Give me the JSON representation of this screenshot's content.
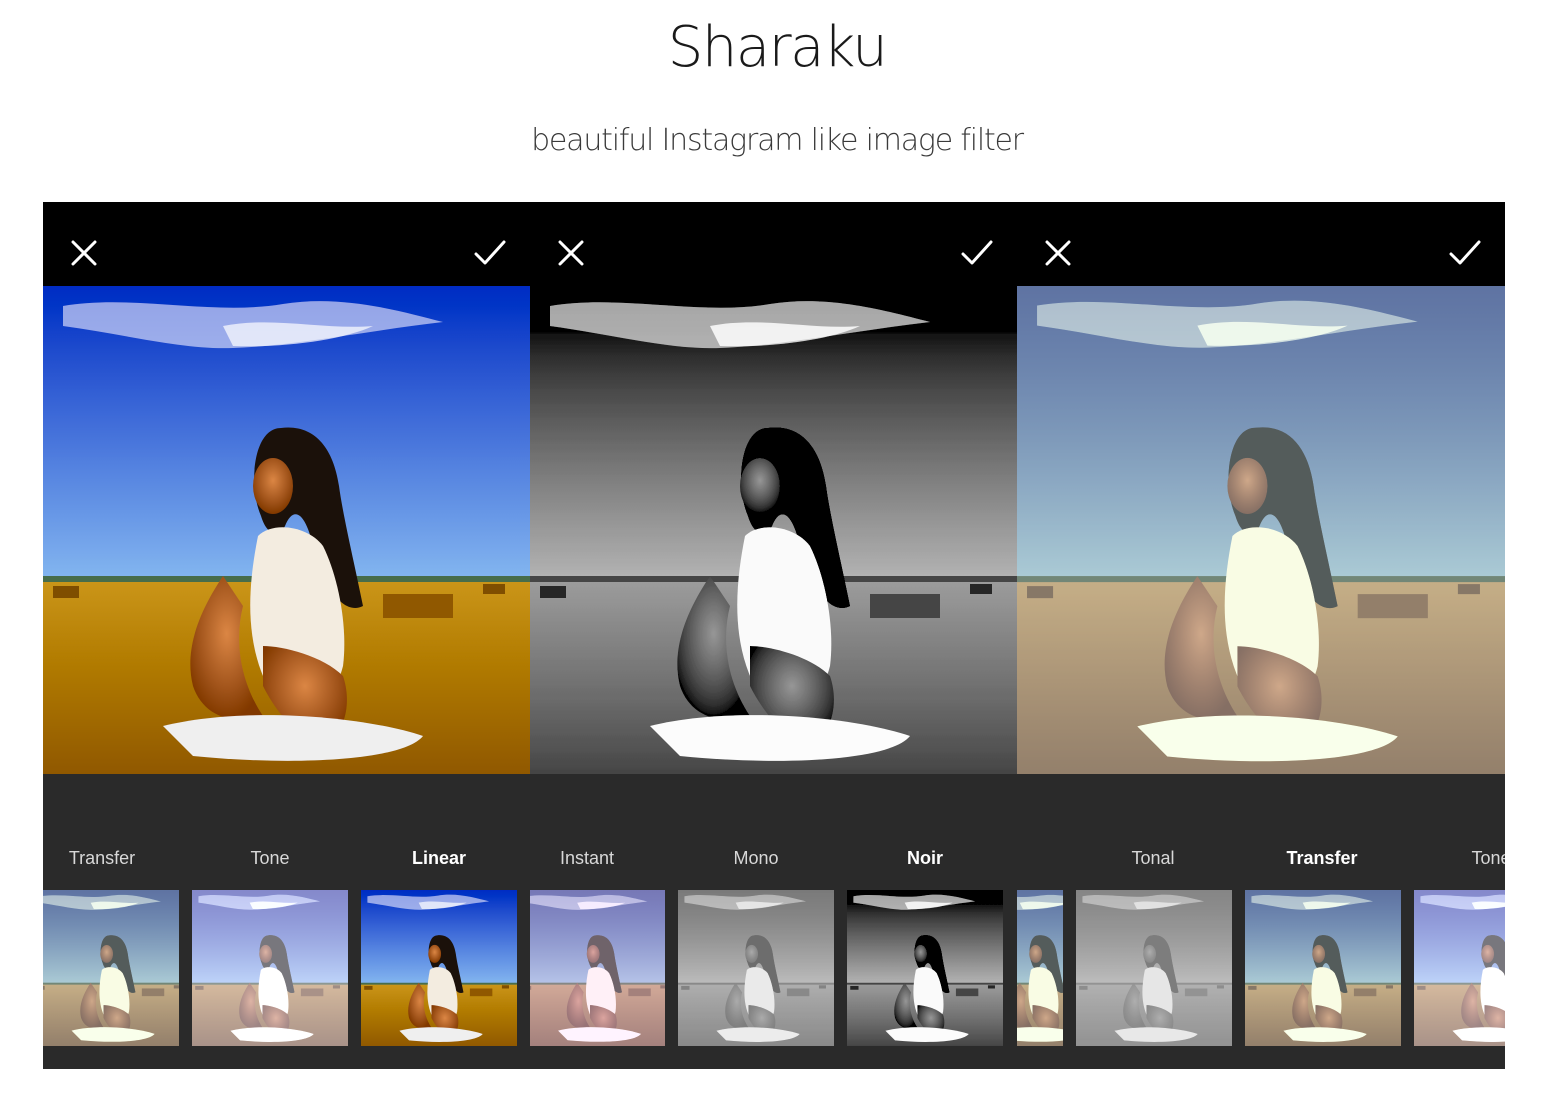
{
  "header": {
    "title": "Sharaku",
    "subtitle": "beautiful Instagram like image filter"
  },
  "screens": [
    {
      "filter_name": "Linear",
      "labels": [
        "Transfer",
        "Tone",
        "Linear"
      ],
      "selected_label": "Linear",
      "icons": {
        "close": "close-icon",
        "confirm": "checkmark-icon"
      }
    },
    {
      "filter_name": "Noir",
      "labels": [
        "Instant",
        "Mono",
        "Noir"
      ],
      "selected_label": "Noir",
      "icons": {
        "close": "close-icon",
        "confirm": "checkmark-icon"
      }
    },
    {
      "filter_name": "Transfer",
      "labels": [
        "Tonal",
        "Transfer",
        "Tone"
      ],
      "selected_label": "Transfer",
      "icons": {
        "close": "close-icon",
        "confirm": "checkmark-icon"
      }
    }
  ],
  "colors": {
    "background": "#ffffff",
    "toolbar": "#000000",
    "panel": "#2a2a2a",
    "label": "#d8d8d8",
    "label_selected": "#ffffff"
  }
}
